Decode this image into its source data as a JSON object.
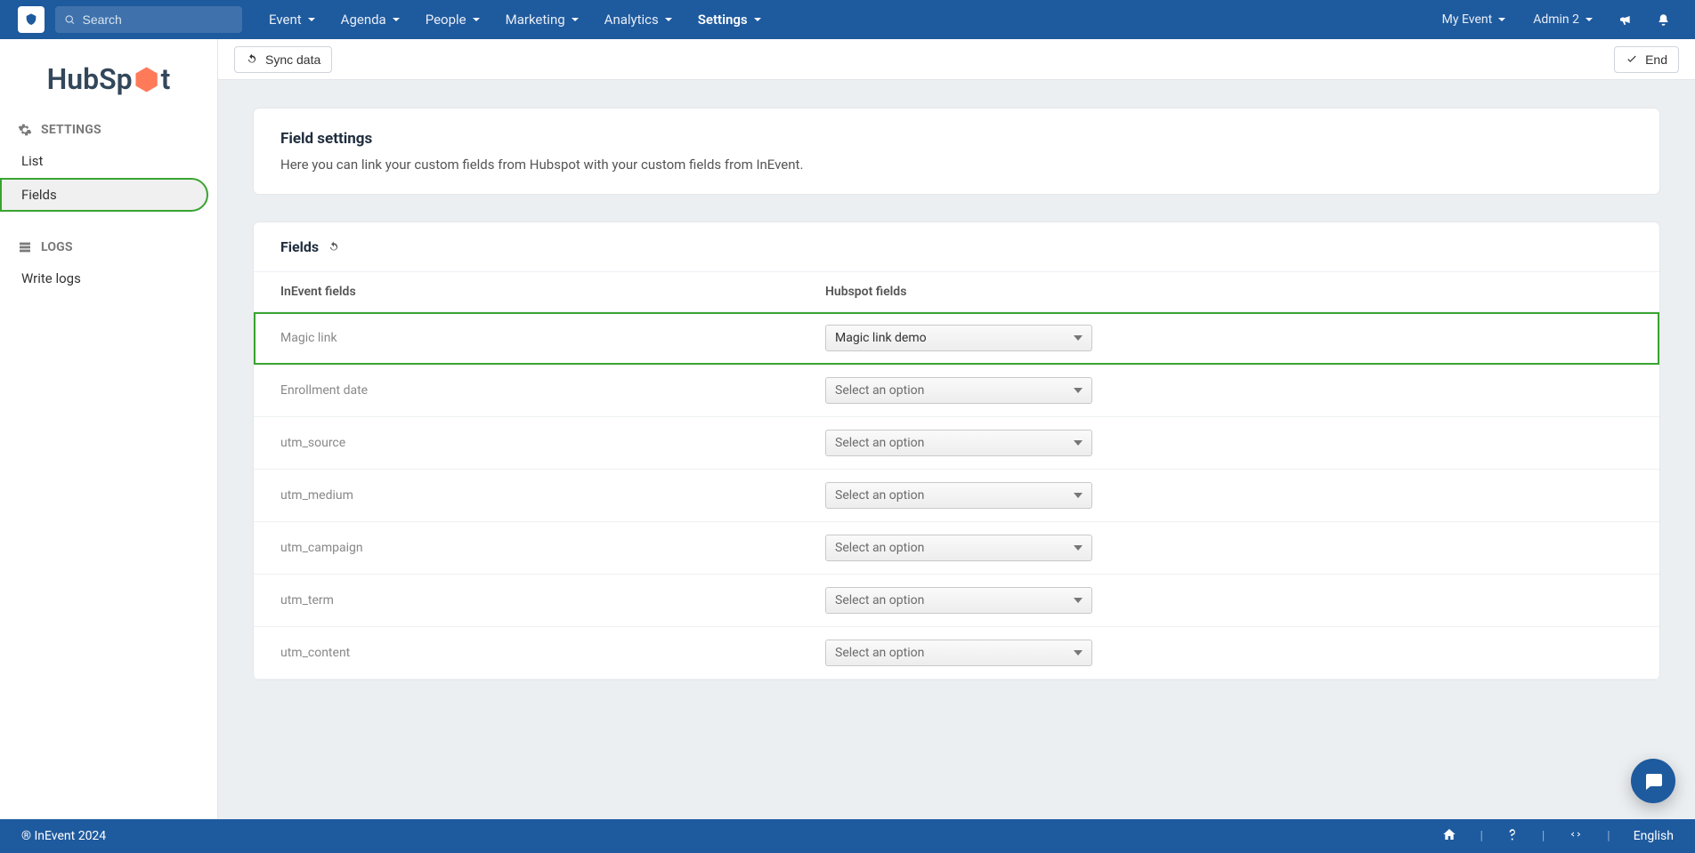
{
  "topbar": {
    "search_placeholder": "Search",
    "menus": [
      {
        "label": "Event"
      },
      {
        "label": "Agenda"
      },
      {
        "label": "People"
      },
      {
        "label": "Marketing"
      },
      {
        "label": "Analytics"
      },
      {
        "label": "Settings",
        "active": true
      }
    ],
    "right": {
      "event_label": "My Event",
      "user_label": "Admin 2"
    }
  },
  "sidebar": {
    "brand": "HubSpot",
    "groups": [
      {
        "label": "SETTINGS",
        "items": [
          {
            "label": "List"
          },
          {
            "label": "Fields",
            "selected": true
          }
        ]
      },
      {
        "label": "LOGS",
        "items": [
          {
            "label": "Write logs"
          }
        ]
      }
    ]
  },
  "toolbar": {
    "sync_label": "Sync data",
    "end_label": "End"
  },
  "field_settings": {
    "title": "Field settings",
    "desc": "Here you can link your custom fields from Hubspot with your custom fields from InEvent."
  },
  "fields_card": {
    "title": "Fields",
    "column_a": "InEvent fields",
    "column_b": "Hubspot fields",
    "placeholder": "Select an option",
    "rows": [
      {
        "inevent": "Magic link",
        "hubspot": "Magic link demo",
        "highlight": true
      },
      {
        "inevent": "Enrollment date",
        "hubspot": null
      },
      {
        "inevent": "utm_source",
        "hubspot": null
      },
      {
        "inevent": "utm_medium",
        "hubspot": null
      },
      {
        "inevent": "utm_campaign",
        "hubspot": null
      },
      {
        "inevent": "utm_term",
        "hubspot": null
      },
      {
        "inevent": "utm_content",
        "hubspot": null
      }
    ]
  },
  "footer": {
    "copyright": "® InEvent 2024",
    "language": "English"
  }
}
